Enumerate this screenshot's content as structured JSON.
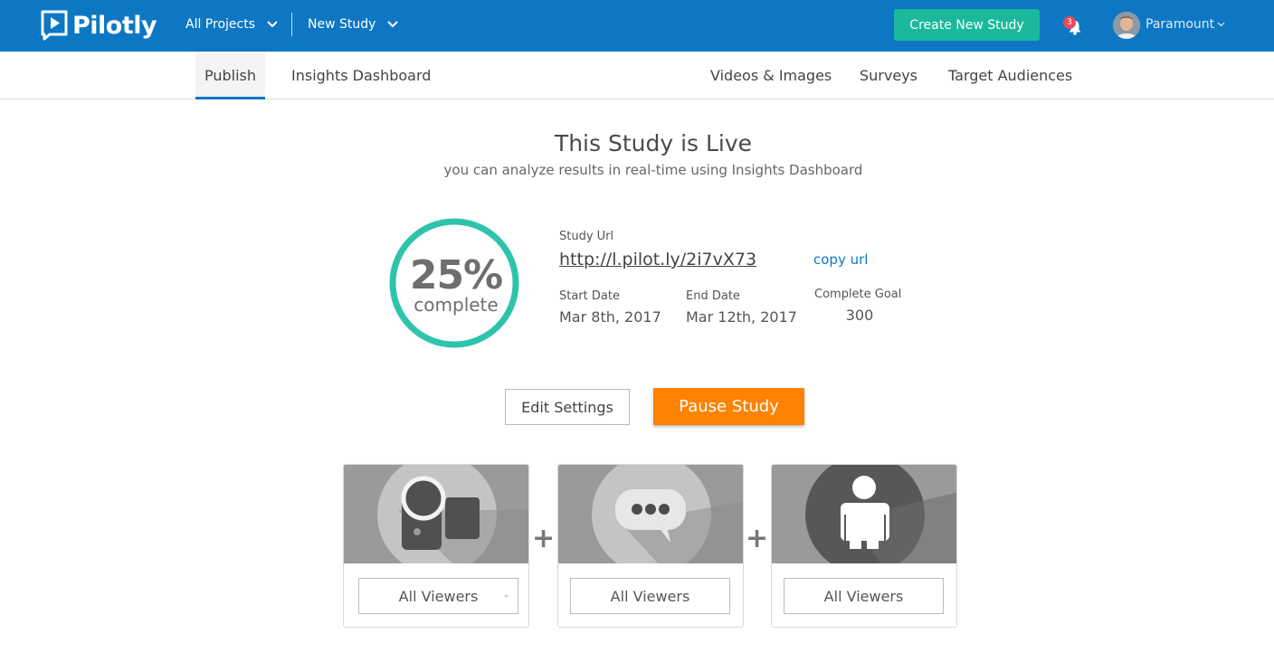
{
  "app": {
    "logo_text": "Pilotly"
  },
  "header": {
    "projects_dropdown": "All Projects",
    "study_dropdown": "New Study",
    "create_button": "Create New Study",
    "notification_count": "3",
    "user_name": "Paramount"
  },
  "tabs": {
    "publish": "Publish",
    "insights": "Insights Dashboard",
    "videos": "Videos & Images",
    "surveys": "Surveys",
    "audiences": "Target Audiences"
  },
  "status": {
    "title": "This Study is Live",
    "subtitle": "you can analyze results in real-time using Insights Dashboard",
    "progress_percent": 25,
    "progress_label": "25%",
    "progress_caption": "complete"
  },
  "details": {
    "url_label": "Study Url",
    "url_value": "http://l.pilot.ly/2i7vX73",
    "copy_label": "copy url",
    "start_label": "Start Date",
    "start_value": "Mar 8th, 2017",
    "end_label": "End Date",
    "end_value": "Mar 12th, 2017",
    "goal_label": "Complete Goal",
    "goal_value": "300"
  },
  "actions": {
    "edit": "Edit Settings",
    "pause": "Pause Study"
  },
  "cards": [
    {
      "icon": "video-camera-icon",
      "select_value": "All Viewers"
    },
    {
      "icon": "chat-bubble-icon",
      "select_value": "All Viewers"
    },
    {
      "icon": "person-icon",
      "select_value": "All Viewers"
    }
  ],
  "colors": {
    "brand_blue": "#0e77c4",
    "teal": "#1ab99c",
    "ring": "#2ec4ac",
    "orange": "#ff8200",
    "badge_red": "#e74c5a"
  }
}
